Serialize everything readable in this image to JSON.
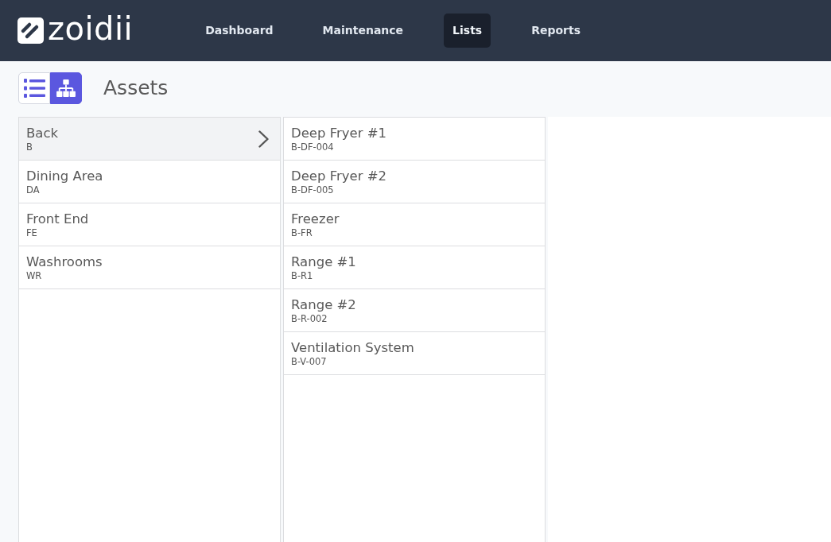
{
  "nav": {
    "logo": "zoidii",
    "items": [
      {
        "label": "Dashboard",
        "selected": false
      },
      {
        "label": "Maintenance",
        "selected": false
      },
      {
        "label": "Lists",
        "selected": true
      },
      {
        "label": "Reports",
        "selected": false
      }
    ]
  },
  "page": {
    "view_toggle": [
      {
        "kind": "list",
        "selected": false
      },
      {
        "kind": "tree",
        "selected": true
      }
    ],
    "title": "Assets"
  },
  "columns": [
    {
      "items": [
        {
          "name": "Back",
          "code": "B",
          "selected": true
        },
        {
          "name": "Dining Area",
          "code": "DA",
          "selected": false
        },
        {
          "name": "Front End",
          "code": "FE",
          "selected": false
        },
        {
          "name": "Washrooms",
          "code": "WR",
          "selected": false
        }
      ]
    },
    {
      "items": [
        {
          "name": "Deep Fryer #1",
          "code": "B-DF-004",
          "selected": false
        },
        {
          "name": "Deep Fryer #2",
          "code": "B-DF-005",
          "selected": false
        },
        {
          "name": "Freezer",
          "code": "B-FR",
          "selected": false
        },
        {
          "name": "Range #1",
          "code": "B-R1",
          "selected": false
        },
        {
          "name": "Range #2",
          "code": "B-R-002",
          "selected": false
        },
        {
          "name": "Ventilation System",
          "code": "B-V-007",
          "selected": false
        }
      ]
    }
  ]
}
